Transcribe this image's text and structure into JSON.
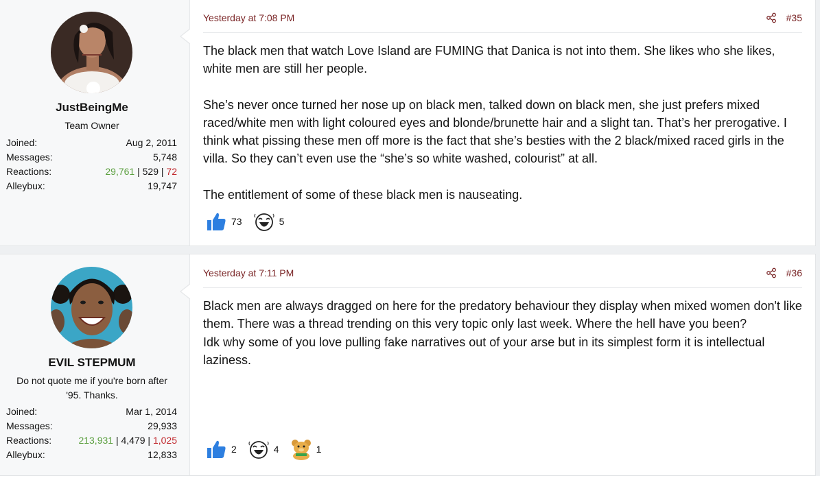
{
  "posts": [
    {
      "user": {
        "name": "JustBeingMe",
        "title": "Team Owner",
        "stats": {
          "joined_label": "Joined:",
          "joined": "Aug 2, 2011",
          "messages_label": "Messages:",
          "messages": "5,748",
          "reactions_label": "Reactions:",
          "reactions_positive": "29,761",
          "reactions_sep1": " | ",
          "reactions_neutral": "529",
          "reactions_sep2": " | ",
          "reactions_negative": "72",
          "alleybux_label": "Alleybux:",
          "alleybux": "19,747"
        }
      },
      "date": "Yesterday at 7:08 PM",
      "number": "#35",
      "paragraphs": [
        "The black men that watch Love Island are FUMING that Danica is not into them. She likes who she likes, white men are still her people.",
        "She’s never once turned her nose up on black men, talked down on black men, she just prefers mixed raced/white men with light coloured eyes and blonde/brunette hair and a slight tan. That’s her prerogative. I think what pissing these men off more is the fact that she’s besties with the 2 black/mixed raced girls in the villa. So they can’t even use the “she’s so white washed, colourist” at all.",
        "The entitlement of some of these black men is nauseating."
      ],
      "reactions": [
        {
          "icon": "thumbs-up-icon",
          "count": "73"
        },
        {
          "icon": "laughing-face-icon",
          "count": "5"
        }
      ]
    },
    {
      "user": {
        "name": "EVIL STEPMUM",
        "title_line1": "Do not quote me if you're born after",
        "title_line2": "'95. Thanks.",
        "stats": {
          "joined_label": "Joined:",
          "joined": "Mar 1, 2014",
          "messages_label": "Messages:",
          "messages": "29,933",
          "reactions_label": "Reactions:",
          "reactions_positive": "213,931",
          "reactions_sep1": " | ",
          "reactions_neutral": "4,479",
          "reactions_sep2": " | ",
          "reactions_negative": "1,025",
          "alleybux_label": "Alleybux:",
          "alleybux": "12,833"
        }
      },
      "date": "Yesterday at 7:11 PM",
      "number": "#36",
      "paragraphs": [
        "Black men are always dragged on here for the predatory behaviour they display when mixed women don't like them. There was a thread trending on this very topic only last week. Where the hell have you been?",
        "Idk why some of you love pulling fake narratives out of your arse but in its simplest form it is intellectual laziness."
      ],
      "reactions": [
        {
          "icon": "thumbs-up-icon",
          "count": "2"
        },
        {
          "icon": "laughing-face-icon",
          "count": "4"
        },
        {
          "icon": "bear-icon",
          "count": "1"
        }
      ]
    }
  ],
  "colors": {
    "link": "#7a2526",
    "positive": "#5b9f3f",
    "negative": "#c0272d",
    "like_blue": "#2d7fe0"
  }
}
